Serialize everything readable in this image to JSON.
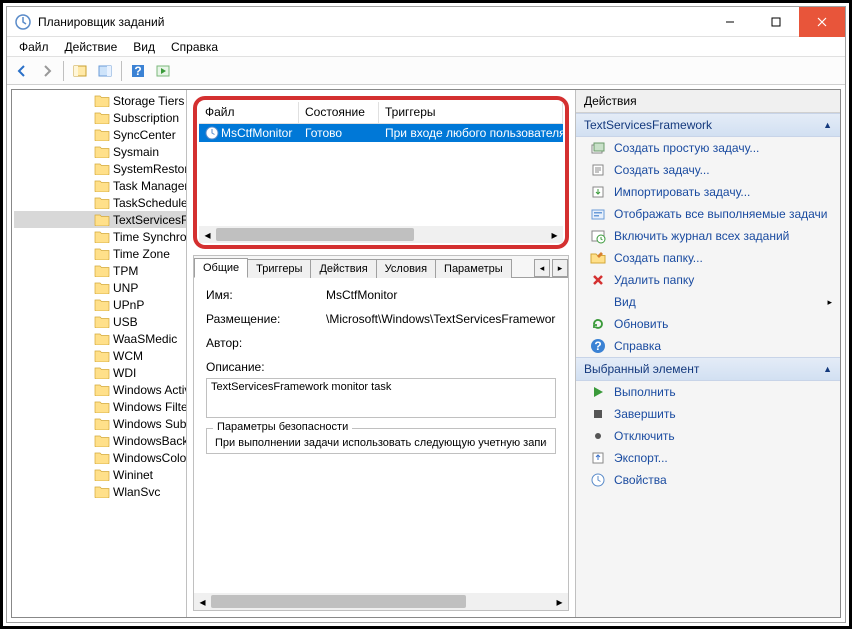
{
  "window": {
    "title": "Планировщик заданий"
  },
  "menu": {
    "file": "Файл",
    "action": "Действие",
    "view": "Вид",
    "help": "Справка"
  },
  "tree": {
    "items": [
      "Storage Tiers",
      "Subscription",
      "SyncCenter",
      "Sysmain",
      "SystemRestore",
      "Task Manager",
      "TaskScheduler",
      "TextServicesFramework",
      "Time Synchronization",
      "Time Zone",
      "TPM",
      "UNP",
      "UPnP",
      "USB",
      "WaaSMedic",
      "WCM",
      "WDI",
      "Windows Activation",
      "Windows Filtering",
      "Windows Subsystem",
      "WindowsBackup",
      "WindowsColor",
      "Wininet",
      "WlanSvc"
    ],
    "selected_index": 7
  },
  "task_list": {
    "headers": {
      "file": "Файл",
      "state": "Состояние",
      "triggers": "Триггеры"
    },
    "row": {
      "name": "MsCtfMonitor",
      "state": "Готово",
      "triggers": "При входе любого пользователя"
    }
  },
  "details": {
    "tabs": {
      "general": "Общие",
      "triggers": "Триггеры",
      "actions": "Действия",
      "conditions": "Условия",
      "settings": "Параметры"
    },
    "fields": {
      "name_label": "Имя:",
      "name_value": "MsCtfMonitor",
      "location_label": "Размещение:",
      "location_value": "\\Microsoft\\Windows\\TextServicesFramework",
      "author_label": "Автор:",
      "author_value": "",
      "description_label": "Описание:",
      "description_value": "TextServicesFramework monitor task"
    },
    "security": {
      "legend": "Параметры безопасности",
      "text": "При выполнении задачи использовать следующую учетную запись:"
    }
  },
  "actions": {
    "title": "Действия",
    "section1": {
      "header": "TextServicesFramework",
      "items": [
        "Создать простую задачу...",
        "Создать задачу...",
        "Импортировать задачу...",
        "Отображать все выполняемые задачи",
        "Включить журнал всех заданий",
        "Создать папку...",
        "Удалить папку",
        "Вид",
        "Обновить",
        "Справка"
      ]
    },
    "section2": {
      "header": "Выбранный элемент",
      "items": [
        "Выполнить",
        "Завершить",
        "Отключить",
        "Экспорт...",
        "Свойства"
      ]
    }
  }
}
